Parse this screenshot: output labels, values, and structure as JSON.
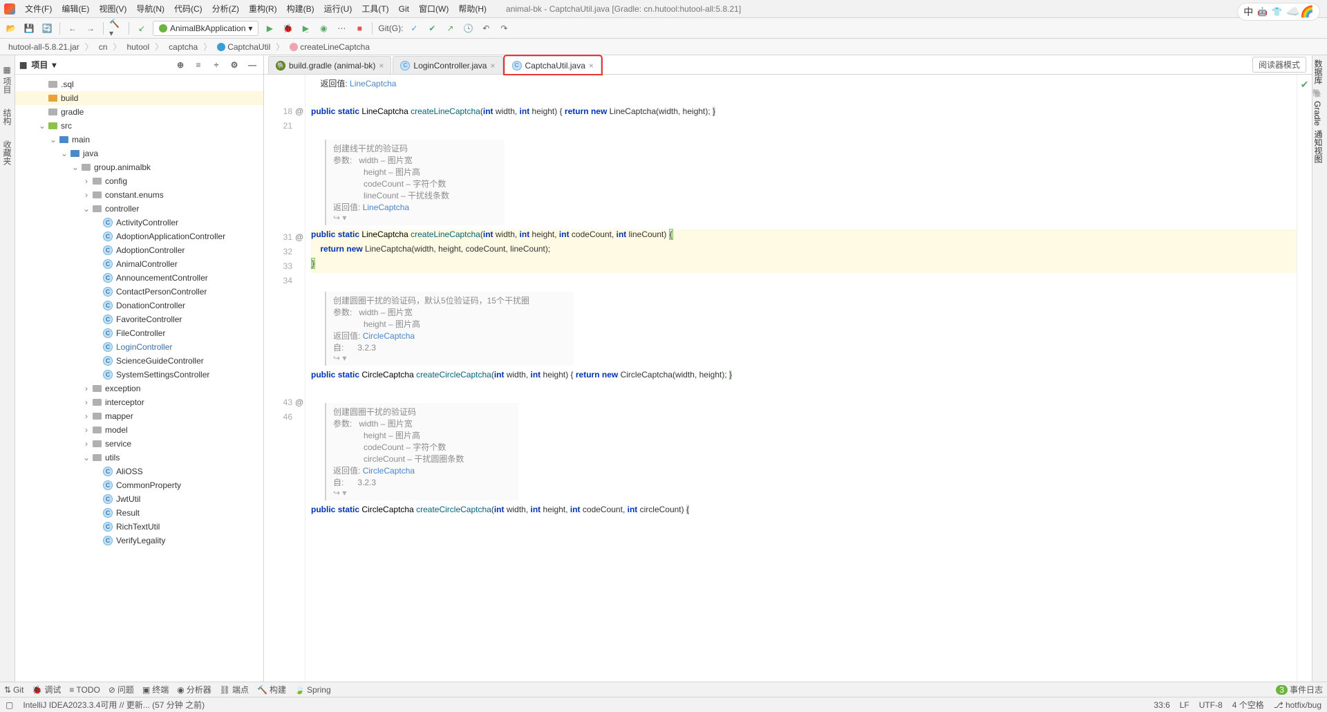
{
  "window": {
    "title": "animal-bk - CaptchaUtil.java [Gradle: cn.hutool:hutool-all:5.8.21]"
  },
  "menu": {
    "file": "文件(F)",
    "edit": "编辑(E)",
    "view": "视图(V)",
    "navigate": "导航(N)",
    "code": "代码(C)",
    "analyze": "分析(Z)",
    "refactor": "重构(R)",
    "build": "构建(B)",
    "run": "运行(U)",
    "tools": "工具(T)",
    "git": "Git",
    "window": "窗口(W)",
    "help": "帮助(H)"
  },
  "toolbar": {
    "run_config": "AnimalBkApplication",
    "git_label": "Git(G):"
  },
  "breadcrumb": [
    "hutool-all-5.8.21.jar",
    "cn",
    "hutool",
    "captcha",
    "CaptchaUtil",
    "createLineCaptcha"
  ],
  "project": {
    "title": "项目",
    "items": [
      {
        "d": 2,
        "arrow": "",
        "icon": "folder-gray",
        "label": ".sql"
      },
      {
        "d": 2,
        "arrow": "",
        "icon": "folder-orange",
        "label": "build",
        "selected": true
      },
      {
        "d": 2,
        "arrow": "",
        "icon": "folder-gray",
        "label": "gradle"
      },
      {
        "d": 2,
        "arrow": "v",
        "icon": "folder-src",
        "label": "src"
      },
      {
        "d": 3,
        "arrow": "v",
        "icon": "folder-blue",
        "label": "main"
      },
      {
        "d": 4,
        "arrow": "v",
        "icon": "folder-blue",
        "label": "java"
      },
      {
        "d": 5,
        "arrow": "v",
        "icon": "folder-gray",
        "label": "group.animalbk"
      },
      {
        "d": 6,
        "arrow": ">",
        "icon": "folder-gray",
        "label": "config"
      },
      {
        "d": 6,
        "arrow": ">",
        "icon": "folder-gray",
        "label": "constant.enums"
      },
      {
        "d": 6,
        "arrow": "v",
        "icon": "folder-gray",
        "label": "controller"
      },
      {
        "d": 7,
        "arrow": "",
        "icon": "class",
        "label": "ActivityController"
      },
      {
        "d": 7,
        "arrow": "",
        "icon": "class",
        "label": "AdoptionApplicationController"
      },
      {
        "d": 7,
        "arrow": "",
        "icon": "class",
        "label": "AdoptionController"
      },
      {
        "d": 7,
        "arrow": "",
        "icon": "class",
        "label": "AnimalController"
      },
      {
        "d": 7,
        "arrow": "",
        "icon": "class",
        "label": "AnnouncementController"
      },
      {
        "d": 7,
        "arrow": "",
        "icon": "class",
        "label": "ContactPersonController"
      },
      {
        "d": 7,
        "arrow": "",
        "icon": "class",
        "label": "DonationController"
      },
      {
        "d": 7,
        "arrow": "",
        "icon": "class",
        "label": "FavoriteController"
      },
      {
        "d": 7,
        "arrow": "",
        "icon": "class",
        "label": "FileController"
      },
      {
        "d": 7,
        "arrow": "",
        "icon": "class",
        "label": "LoginController",
        "link": true
      },
      {
        "d": 7,
        "arrow": "",
        "icon": "class",
        "label": "ScienceGuideController"
      },
      {
        "d": 7,
        "arrow": "",
        "icon": "class",
        "label": "SystemSettingsController"
      },
      {
        "d": 6,
        "arrow": ">",
        "icon": "folder-gray",
        "label": "exception"
      },
      {
        "d": 6,
        "arrow": ">",
        "icon": "folder-gray",
        "label": "interceptor"
      },
      {
        "d": 6,
        "arrow": ">",
        "icon": "folder-gray",
        "label": "mapper"
      },
      {
        "d": 6,
        "arrow": ">",
        "icon": "folder-gray",
        "label": "model"
      },
      {
        "d": 6,
        "arrow": ">",
        "icon": "folder-gray",
        "label": "service"
      },
      {
        "d": 6,
        "arrow": "v",
        "icon": "folder-gray",
        "label": "utils"
      },
      {
        "d": 7,
        "arrow": "",
        "icon": "class",
        "label": "AliOSS"
      },
      {
        "d": 7,
        "arrow": "",
        "icon": "class",
        "label": "CommonProperty"
      },
      {
        "d": 7,
        "arrow": "",
        "icon": "class",
        "label": "JwtUtil"
      },
      {
        "d": 7,
        "arrow": "",
        "icon": "class",
        "label": "Result"
      },
      {
        "d": 7,
        "arrow": "",
        "icon": "class",
        "label": "RichTextUtil"
      },
      {
        "d": 7,
        "arrow": "",
        "icon": "class",
        "label": "VerifyLegality"
      }
    ]
  },
  "tabs": [
    {
      "label": "build.gradle (animal-bk)",
      "icon": "gradle"
    },
    {
      "label": "LoginController.java",
      "icon": "class"
    },
    {
      "label": "CaptchaUtil.java",
      "icon": "class",
      "active": true,
      "highlight": true
    }
  ],
  "reader_mode": "阅读器模式",
  "editor": {
    "prev_return": "返回值:",
    "prev_return_type": "LineCaptcha",
    "javadoc1": {
      "title": "创建线干扰的验证码",
      "params_label": "参数:",
      "p1": "width – 图片宽",
      "p2": "height – 图片高",
      "p3": "codeCount – 字符个数",
      "p4": "lineCount – 干扰线条数",
      "return_label": "返回值:",
      "return_type": "LineCaptcha"
    },
    "javadoc2": {
      "title": "创建圆圈干扰的验证码，默认5位验证码，15个干扰圈",
      "params_label": "参数:",
      "p1": "width – 图片宽",
      "p2": "height – 图片高",
      "return_label": "返回值:",
      "return_type": "CircleCaptcha",
      "since_label": "自:",
      "since_val": "3.2.3"
    },
    "javadoc3": {
      "title": "创建圆圈干扰的验证码",
      "params_label": "参数:",
      "p1": "width – 图片宽",
      "p2": "height – 图片高",
      "p3": "codeCount – 字符个数",
      "p4": "circleCount – 干扰圆圈条数",
      "return_label": "返回值:",
      "return_type": "CircleCaptcha",
      "since_label": "自:",
      "since_val": "3.2.3"
    },
    "line_18": "18",
    "line_21": "21",
    "line_31": "31",
    "line_32": "32",
    "line_33": "33",
    "line_34": "34",
    "line_43": "43",
    "line_46": "46"
  },
  "side_tabs_left": {
    "project": "项目",
    "structure": "结构",
    "bookmarks": "收藏夹"
  },
  "side_tabs_right": {
    "db": "数据库",
    "gradle": "Gradle",
    "notif": "通知视图"
  },
  "bottom_tools": {
    "git": "Git",
    "debug": "调试",
    "todo": "TODO",
    "problems": "问题",
    "terminal": "终端",
    "profiler": "分析器",
    "endpoints": "端点",
    "build": "构建",
    "spring": "Spring",
    "events": "事件日志"
  },
  "statusbar": {
    "msg": "IntelliJ IDEA2023.3.4可用 // 更新... (57 分钟 之前)",
    "pos": "33:6",
    "sep": "LF",
    "enc": "UTF-8",
    "indent": "4 个空格",
    "branch": "hotfix/bug"
  },
  "input_indicator": "中",
  "events_badge": "3"
}
